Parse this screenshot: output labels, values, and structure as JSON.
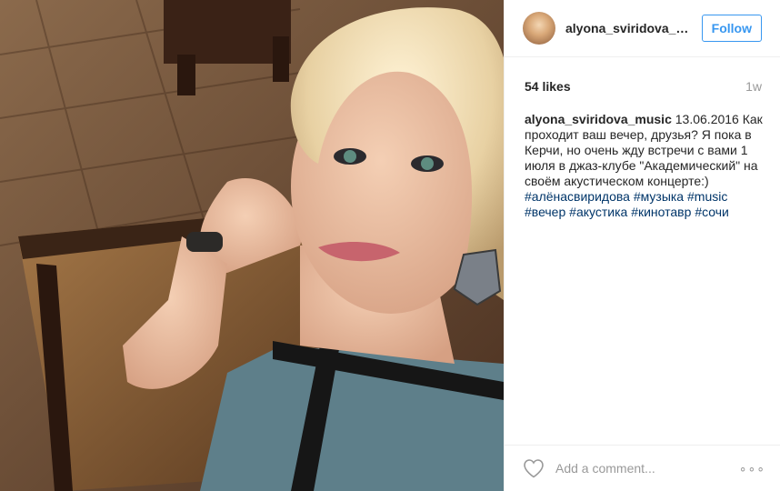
{
  "post": {
    "image_alt": "Selfie photo"
  },
  "header": {
    "username": "alyona_sviridova_m...",
    "follow_label": "Follow"
  },
  "stats": {
    "likes": "54 likes",
    "age": "1w"
  },
  "caption": {
    "username": "alyona_sviridova_music",
    "text": " 13.06.2016 Как проходит ваш вечер, друзья? Я пока в Керчи, но очень жду встречи с вами 1 июля в джаз-клубе \"Академический\" на своём акустическом концерте:)",
    "tags": [
      "#алёнасвиридова",
      "#музыка",
      "#music",
      "#вечер",
      "#акустика",
      "#кинотавр",
      "#сочи"
    ]
  },
  "footer": {
    "comment_placeholder": "Add a comment...",
    "more_label": "∘∘∘"
  },
  "colors": {
    "accent": "#3897f0",
    "hashtag": "#003569",
    "muted": "#999999"
  },
  "icons": {
    "like": "heart-icon",
    "options": "more-options-icon"
  }
}
